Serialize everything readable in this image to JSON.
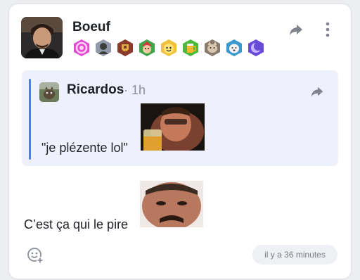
{
  "post": {
    "author": "Boeuf",
    "badges": [
      "swirl-badge",
      "portrait-badge",
      "crest-badge",
      "elf-badge",
      "cloud-face-badge",
      "beer-badge",
      "cat-badge",
      "dog-badge",
      "moon-badge"
    ],
    "text": "C’est ça qui le pire",
    "timestamp": "il y a 36 minutes",
    "share_icon": "share-icon",
    "more_icon": "more-vertical-icon",
    "reaction_icon": "add-reaction-icon"
  },
  "quote": {
    "author": "Ricardos",
    "separator": "·",
    "time": "1h",
    "text": "\"je plézente lol\"",
    "share_icon": "share-icon"
  },
  "colors": {
    "accent": "#4a7ef0",
    "quote_bg": "#eef1fc",
    "card_bg": "#ffffff",
    "muted": "#8a8f99"
  }
}
